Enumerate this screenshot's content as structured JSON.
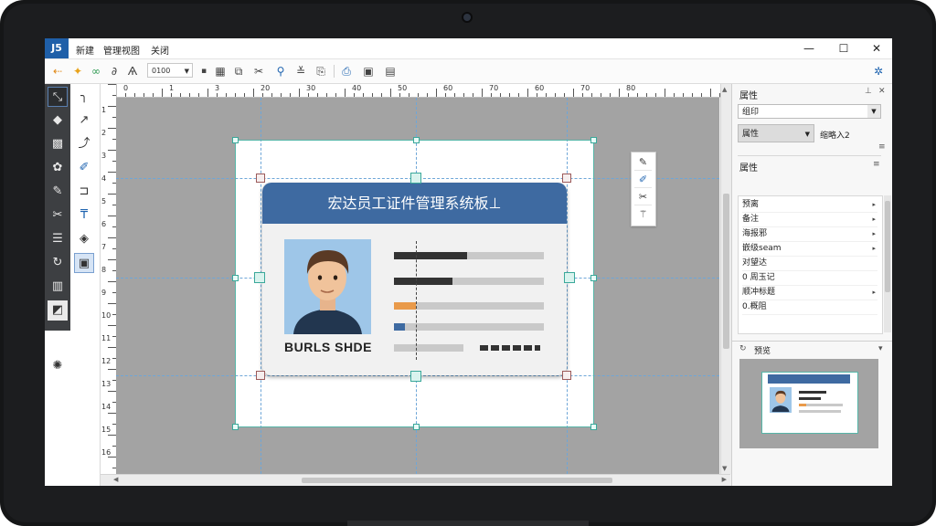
{
  "titlebar": {
    "app_badge": "J5",
    "menu": [
      "新建",
      "管理视图",
      "关闭"
    ],
    "minimize": "—",
    "maximize": "☐",
    "close": "✕"
  },
  "toolbar": {
    "zoom_select": "0100"
  },
  "ruler": {
    "top_labels": [
      "0",
      "1",
      "3",
      "20",
      "30",
      "40",
      "50",
      "60",
      "70",
      "60",
      "70",
      "80"
    ],
    "left_labels": [
      "1",
      "2",
      "3",
      "4",
      "5",
      "6",
      "7",
      "8",
      "9",
      "10",
      "11",
      "12",
      "13",
      "14",
      "15",
      "16"
    ]
  },
  "card": {
    "title": "宏达员工证件管理系统板⊥",
    "name": "BURLS SHDE"
  },
  "panel": {
    "header": "属性",
    "dropdown": "组印",
    "mode": "属性",
    "mode_extra": "缩略入2",
    "section": "属性",
    "items": [
      {
        "label": "预离",
        "chevron": true
      },
      {
        "label": "备注",
        "chevron": true
      },
      {
        "label": "海报邪",
        "chevron": true
      },
      {
        "label": "嵌级seam",
        "chevron": true
      },
      {
        "label": "对望达",
        "chevron": false
      },
      {
        "label": "0 周玉记",
        "chevron": false
      },
      {
        "label": "顺冲标题",
        "chevron": true
      },
      {
        "label": "0.概阻",
        "chevron": false
      }
    ],
    "preview_header": "预览",
    "preview_collapse": "▾"
  }
}
